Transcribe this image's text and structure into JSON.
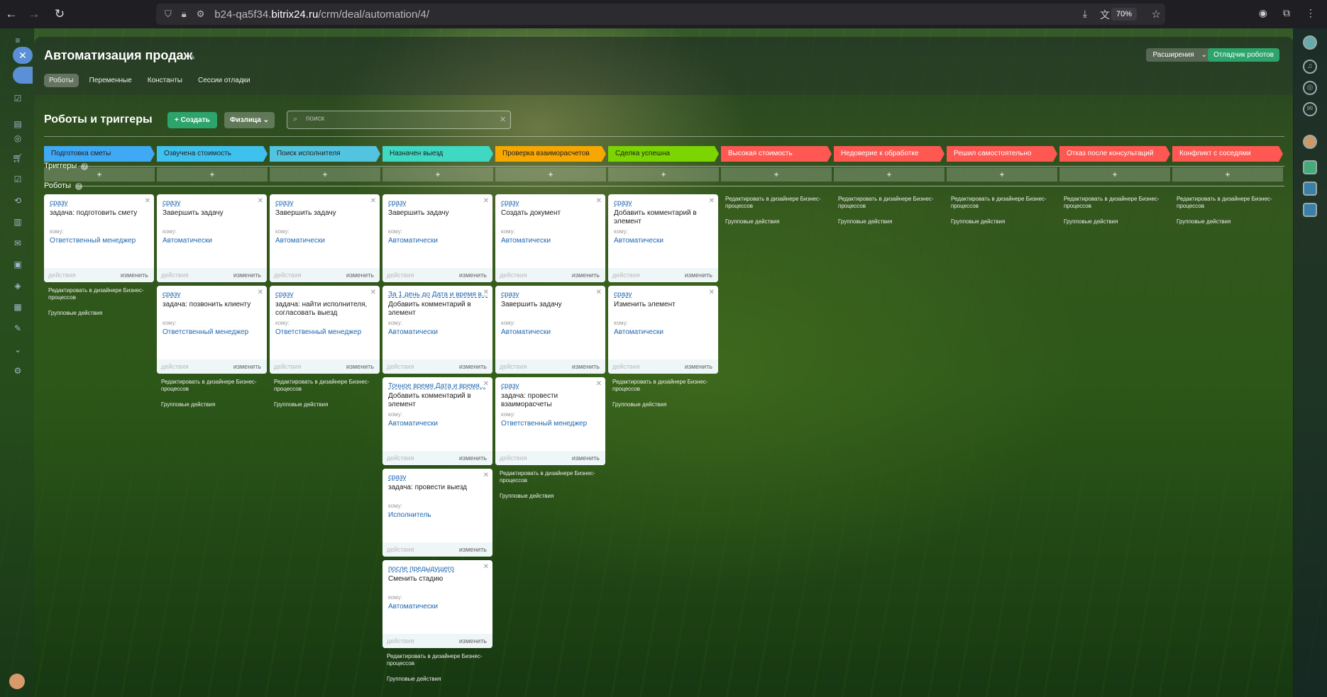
{
  "browser": {
    "url_prefix": "b24-qa5f34.",
    "url_domain": "bitrix24.ru",
    "url_path": "/crm/deal/automation/4/",
    "zoom": "70%"
  },
  "page": {
    "title": "Автоматизация продаж",
    "tabs": [
      {
        "label": "Роботы"
      },
      {
        "label": "Переменные"
      },
      {
        "label": "Константы"
      },
      {
        "label": "Сессии отладки"
      }
    ],
    "extensions_label": "Расширения",
    "debugger_label": "Отладчик роботов",
    "section_title": "Роботы и триггеры",
    "create_label": "Создать",
    "filter_label": "Физлица",
    "search_placeholder": "поиск",
    "triggers_label": "Триггеры",
    "robots_label": "Роботы",
    "edit_designer": "Редактировать в дизайнере Бизнес-процессов",
    "group_actions": "Групповые действия",
    "actions_label": "действия",
    "change_label": "изменить",
    "whom_label": "кому:",
    "plus": "+"
  },
  "stages": [
    {
      "name": "Подготовка сметы",
      "color": "#3fa9f5"
    },
    {
      "name": "Озвучена стоимость",
      "color": "#3fc1f0"
    },
    {
      "name": "Поиск исполнителя",
      "color": "#52c4e0"
    },
    {
      "name": "Назначен выезд",
      "color": "#3ed8c3"
    },
    {
      "name": "Проверка взаиморасчетов",
      "color": "#f7a700"
    },
    {
      "name": "Сделка успешна",
      "color": "#7bd500"
    },
    {
      "name": "Высокая стоимость",
      "color": "#ff5752"
    },
    {
      "name": "Недоверие к обработке",
      "color": "#ff5752"
    },
    {
      "name": "Решил самостоятельно",
      "color": "#ff5752"
    },
    {
      "name": "Отказ после консультаций",
      "color": "#ff5752"
    },
    {
      "name": "Конфликт с соседями",
      "color": "#ff5752"
    }
  ],
  "robots": [
    [
      {
        "when": "сразу",
        "name": "задача: подготовить смету",
        "who": "Ответственный менеджер"
      }
    ],
    [
      {
        "when": "сразу",
        "name": "Завершить задачу",
        "who": "Автоматически"
      },
      {
        "when": "сразу",
        "name": "задача: позвонить клиенту",
        "who": "Ответственный менеджер"
      }
    ],
    [
      {
        "when": "сразу",
        "name": "Завершить задачу",
        "who": "Автоматически"
      },
      {
        "when": "сразу",
        "name": "задача: найти исполнителя, согласовать выезд",
        "who": "Ответственный менеджер"
      }
    ],
    [
      {
        "when": "сразу",
        "name": "Завершить задачу",
        "who": "Автоматически"
      },
      {
        "when": "За 1 день до Дата и время в...",
        "name": "Добавить комментарий в элемент",
        "who": "Автоматически"
      },
      {
        "when": "Точное время Дата и время...",
        "name": "Добавить комментарий в элемент",
        "who": "Автоматически"
      },
      {
        "when": "сразу",
        "name": "задача: провести выезд",
        "who": "Исполнитель"
      },
      {
        "when": "после предыдущего",
        "name": "Сменить стадию",
        "who": "Автоматически"
      }
    ],
    [
      {
        "when": "сразу",
        "name": "Создать документ",
        "who": "Автоматически"
      },
      {
        "when": "сразу",
        "name": "Завершить задачу",
        "who": "Автоматически"
      },
      {
        "when": "сразу",
        "name": "задача: провести взаиморасчеты",
        "who": "Ответственный менеджер"
      }
    ],
    [
      {
        "when": "сразу",
        "name": "Добавить комментарий в элемент",
        "who": "Автоматически"
      },
      {
        "when": "сразу",
        "name": "Изменить элемент",
        "who": "Автоматически"
      }
    ],
    [],
    [],
    [],
    [],
    []
  ]
}
